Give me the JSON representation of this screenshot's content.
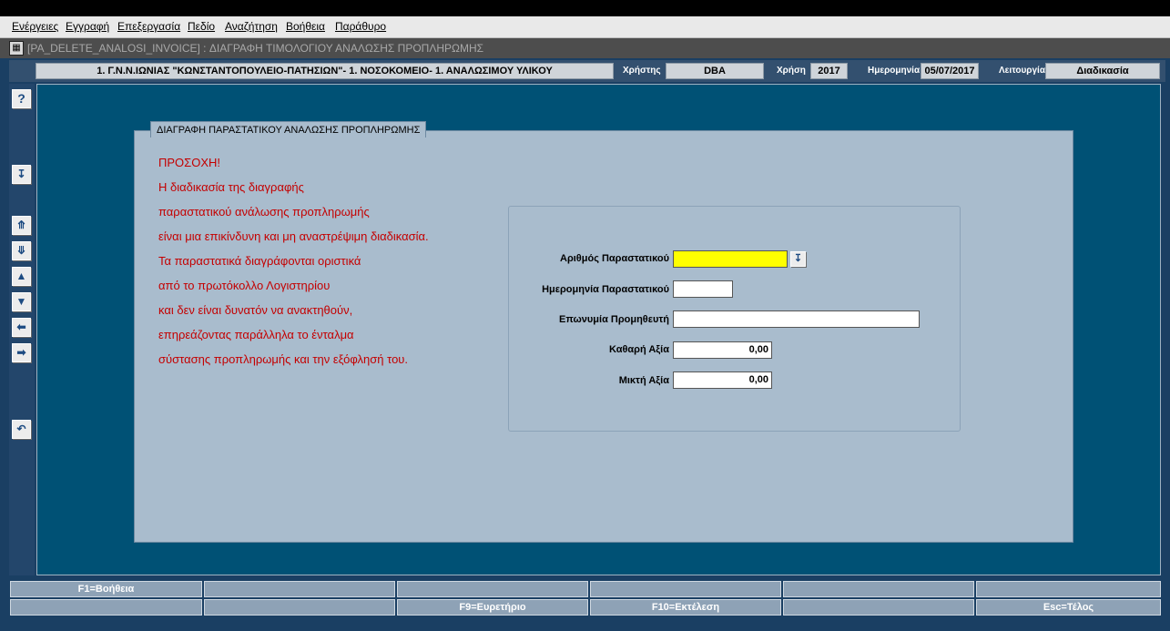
{
  "menu": [
    "Ενέργειες",
    "Εγγραφή",
    "Επεξεργασία",
    "Πεδίο",
    "Αναζήτηση",
    "Βοήθεια",
    "Παράθυρο"
  ],
  "window_title": "[PA_DELETE_ANALOSI_INVOICE]  :  ΔΙΑΓΡΑΦΗ ΤΙΜΟΛΟΓΙΟΥ ΑΝΑΛΩΣΗΣ ΠΡΟΠΛΗΡΩΜΗΣ",
  "header": {
    "organization": "1. Γ.Ν.Ν.ΙΩΝΙΑΣ \"ΚΩΝΣΤΑΝΤΟΠΟΥΛΕΙΟ-ΠΑΤΗΣΙΩΝ\"- 1. ΝΟΣΟΚΟΜΕΙΟ- 1. ΑΝΑΛΩΣΙΜΟΥ ΥΛΙΚΟΥ",
    "user_label": "Χρήστης",
    "user_value": "DBA",
    "year_label": "Χρήση",
    "year_value": "2017",
    "date_label": "Ημερομηνία",
    "date_value": "05/07/2017",
    "function_label": "Λειτουργία",
    "function_value": "Διαδικασία"
  },
  "toolbar_icons": [
    "help-icon",
    "download-icon",
    "first-record-icon",
    "last-record-icon",
    "previous-record-icon",
    "next-record-icon",
    "previous-block-icon",
    "next-block-icon",
    "undo-icon"
  ],
  "panel_title": "ΔΙΑΓΡΑΦΗ ΠΑΡΑΣΤΑΤΙΚΟΥ ΑΝΑΛΩΣΗΣ ΠΡΟΠΛΗΡΩΜΗΣ",
  "warning_lines": [
    "ΠΡΟΣΟΧΗ!",
    "Η διαδικασία της διαγραφής",
    "παραστατικού ανάλωσης προπληρωμής",
    "είναι μια επικίνδυνη και μη αναστρέψιμη διαδικασία.",
    "Τα παραστατικά διαγράφονται οριστικά",
    "από το πρωτόκολλο Λογιστηρίου",
    "και δεν είναι δυνατόν να ανακτηθούν,",
    "επηρεάζοντας παράλληλα το ένταλμα",
    "σύστασης προπληρωμής και την εξόφλησή του."
  ],
  "form": {
    "doc_number_label": "Αριθμός Παραστατικού",
    "doc_number_value": "",
    "doc_date_label": "Ημερομηνία Παραστατικού",
    "doc_date_value": "",
    "supplier_label": "Επωνυμία Προμηθευτή",
    "supplier_value": "",
    "net_value_label": "Καθαρή Αξία",
    "net_value": "0,00",
    "gross_value_label": "Μικτή Αξία",
    "gross_value": "0,00"
  },
  "function_keys": {
    "row1": [
      "F1=Βοήθεια",
      "",
      "",
      "",
      "",
      ""
    ],
    "row2": [
      "",
      "",
      "F9=Ευρετήριο",
      "F10=Εκτέλεση",
      "",
      "Esc=Τέλος"
    ]
  },
  "colors": {
    "background": "#005175",
    "panel": "#a9bccd",
    "warning_text": "#c40000",
    "focused_field": "#ffff00"
  }
}
